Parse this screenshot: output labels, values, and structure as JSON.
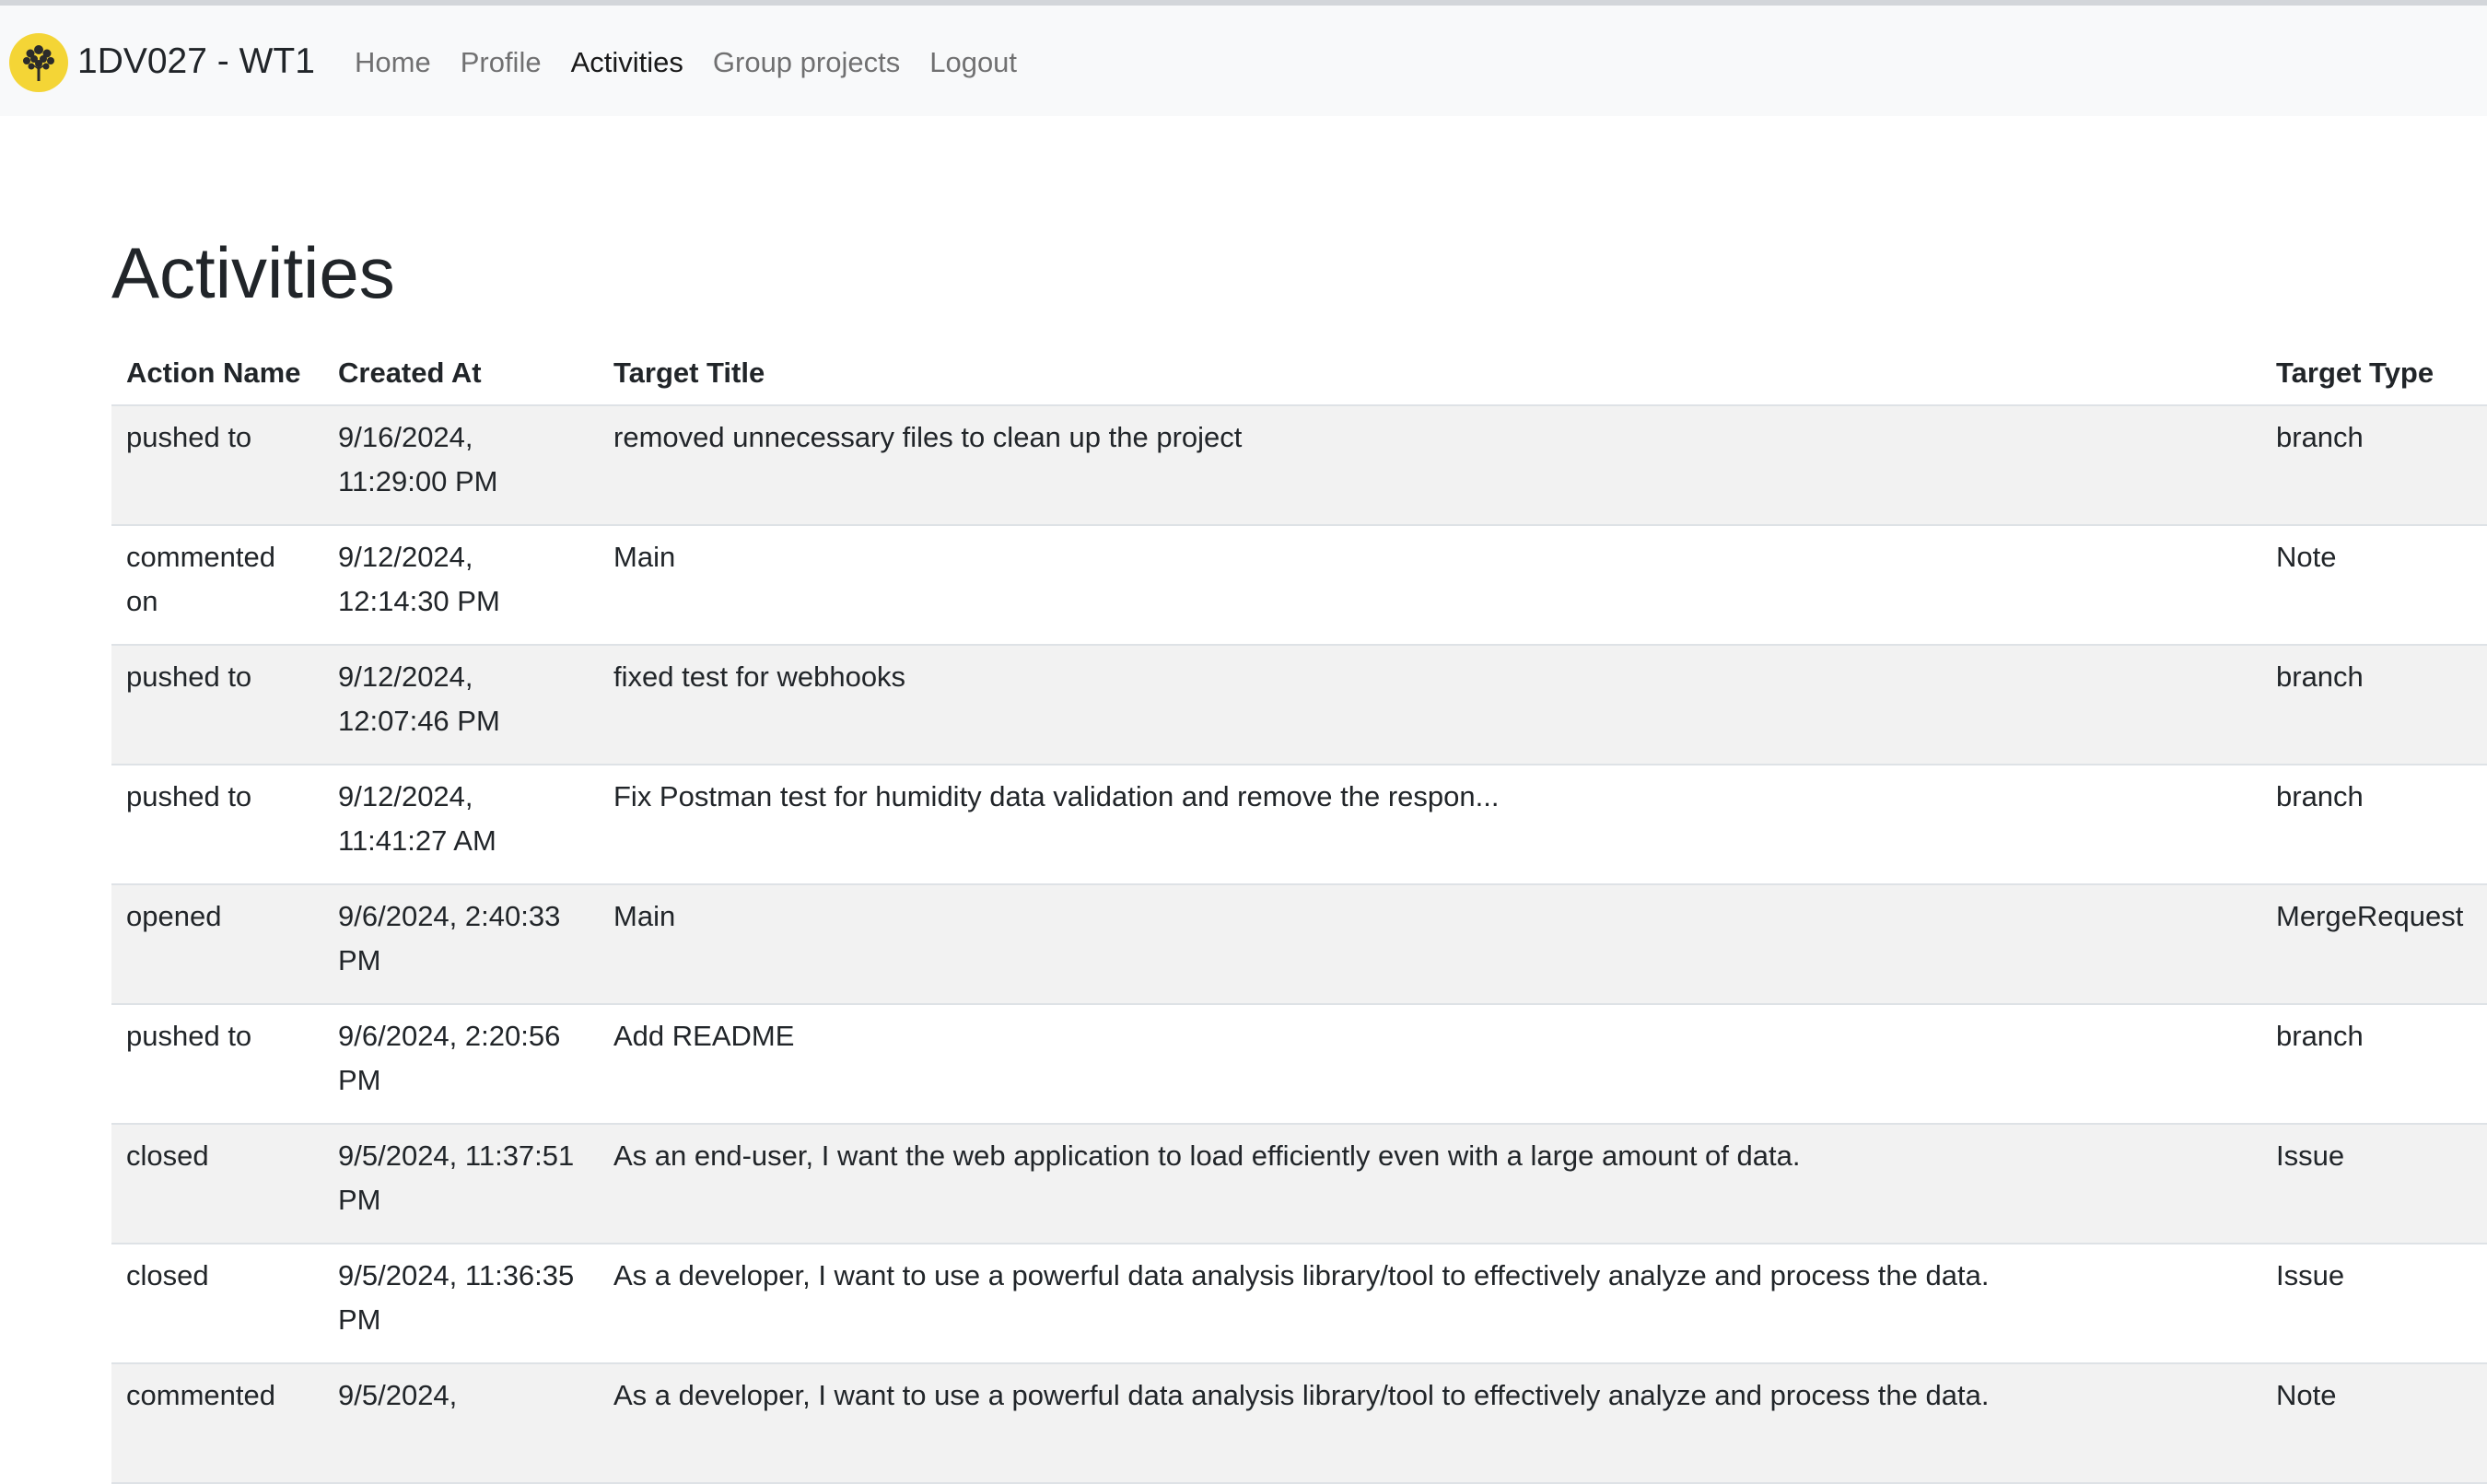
{
  "navbar": {
    "brand": "1DV027 - WT1",
    "links": [
      {
        "label": "Home"
      },
      {
        "label": "Profile"
      },
      {
        "label": "Activities"
      },
      {
        "label": "Group projects"
      },
      {
        "label": "Logout"
      }
    ],
    "active": "Activities"
  },
  "page": {
    "title": "Activities"
  },
  "table": {
    "headers": [
      "Action Name",
      "Created At",
      "Target Title",
      "Target Type"
    ],
    "rows": [
      {
        "action": "pushed to",
        "created": "9/16/2024, 11:29:00 PM",
        "title": "removed unnecessary files to clean up the project",
        "type": "branch"
      },
      {
        "action": "commented on",
        "created": "9/12/2024, 12:14:30 PM",
        "title": "Main",
        "type": "Note"
      },
      {
        "action": "pushed to",
        "created": "9/12/2024, 12:07:46 PM",
        "title": "fixed test for webhooks",
        "type": "branch"
      },
      {
        "action": "pushed to",
        "created": "9/12/2024, 11:41:27 AM",
        "title": "Fix Postman test for humidity data validation and remove the respon...",
        "type": "branch"
      },
      {
        "action": "opened",
        "created": "9/6/2024, 2:40:33 PM",
        "title": "Main",
        "type": "MergeRequest"
      },
      {
        "action": "pushed to",
        "created": "9/6/2024, 2:20:56 PM",
        "title": "Add README",
        "type": "branch"
      },
      {
        "action": "closed",
        "created": "9/5/2024, 11:37:51 PM",
        "title": "As an end-user, I want the web application to load efficiently even with a large amount of data.",
        "type": "Issue"
      },
      {
        "action": "closed",
        "created": "9/5/2024, 11:36:35 PM",
        "title": "As a developer, I want to use a powerful data analysis library/tool to effectively analyze and process the data.",
        "type": "Issue"
      },
      {
        "action": "commented",
        "created": "9/5/2024,",
        "title": "As a developer, I want to use a powerful data analysis library/tool to effectively analyze and process the data.",
        "type": "Note"
      }
    ]
  },
  "colors": {
    "navbar_bg": "#f8f9fa",
    "logo_bg": "#f4d536",
    "stripe_bg": "#f2f2f2",
    "text": "#212529"
  },
  "icons": {
    "logo": "tree-icon"
  }
}
